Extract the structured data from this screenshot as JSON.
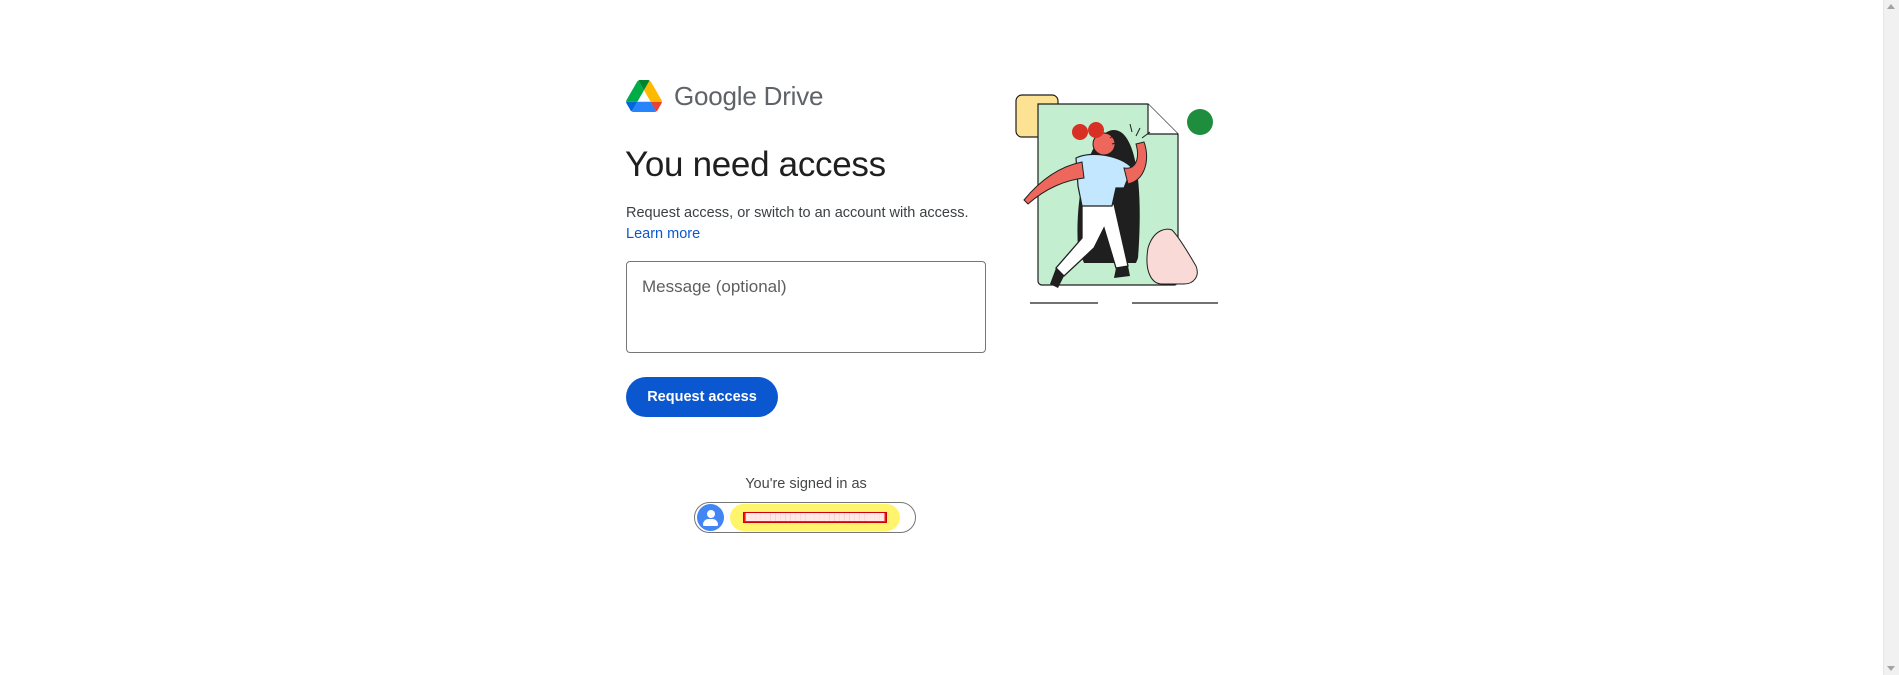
{
  "header": {
    "brand_google": "Google",
    "brand_product": "Drive",
    "logo_icon": "google-drive-logo"
  },
  "main": {
    "title": "You need access",
    "description": "Request access, or switch to an account with access.",
    "learn_more": "Learn more",
    "message_placeholder": "Message (optional)",
    "message_value": "",
    "request_button": "Request access"
  },
  "account": {
    "signed_in_label": "You're signed in as",
    "email": "████████████████████████████",
    "avatar_icon": "person-avatar-icon",
    "redaction_color": "#ff1010",
    "highlight_color": "#fff46b"
  },
  "illustration": {
    "subject": "person-walking-out-of-document-illustration"
  },
  "colors": {
    "primary": "#0b57d0",
    "text": "#1f1f1f",
    "secondary_text": "#444746"
  }
}
